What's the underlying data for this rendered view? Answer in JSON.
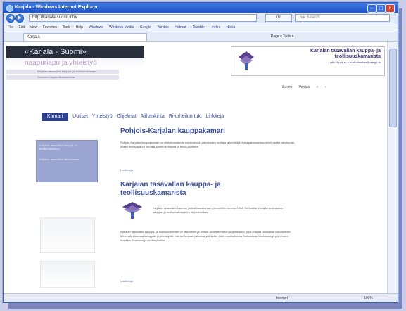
{
  "window": {
    "title": "Karjala - Windows Internet Explorer",
    "address": "http://karjala-suomi.info/",
    "search_placeholder": "Live Search",
    "go_label": "Go",
    "tab_label": "Karjala"
  },
  "menus": [
    "File",
    "Edit",
    "View",
    "Favorites",
    "Tools",
    "Help"
  ],
  "links": [
    "Windows",
    "Windows Media",
    "Google",
    "Yandex",
    "Hotmail",
    "Rambler",
    "Index",
    "Nokia"
  ],
  "tab_tools": "Page ▾  Tools ▾",
  "site": {
    "title": "«Karjala - Suomi»",
    "subtitle": "naapuriapu ja yhteistyö",
    "line1": "Karjalan tasavallan kauppa- ja teollisuuskamari",
    "line2": "Suomen-Karjala liiketoimintaa"
  },
  "banner": {
    "line1": "Karjalan tasavallan kauppa- ja",
    "line2": "teollisuuskamarista",
    "line3": "http://kppk.ru   e-mail:chamber@onego.ru"
  },
  "lang_links": [
    "Suomi",
    "Venäjä",
    "»",
    "«"
  ],
  "nav": {
    "active": "Kamari",
    "items": [
      "Uutiset",
      "Yhteistyö",
      "Ohjelmat",
      "Alihankinta",
      "Ri-urheilun tuki",
      "Linkkejä"
    ]
  },
  "left_box": {
    "item1": "Karjalan tasavallan kauppa- ja teollisuuskamari",
    "item2": "Karjalan tasavallan talousalueet"
  },
  "article1": {
    "title": "Pohjois-Karjalan kauppakamari",
    "body": "Pohjois-Karjalan kauppakamari on elinkeinoelämän edunvalvoja, palveluiden tuottaja ja kehittäjä. Kauppakamarissa toimii useita valiokuntia, joiden tehtävänä on seurata alueen kehitystä ja tehdä aloitteita.",
    "more": "Lisätietoja"
  },
  "article2": {
    "title": "Karjalan tasavallan kauppa- ja teollisuuskamarista",
    "intro": "Karjalan tasavallan kauppa- ja teollisuuskamari perustettiin vuonna 1992. Se kuuluu Venäjän federaation kauppa- ja teollisuuskamarien järjestelmään.",
    "body": "Karjalan tasavallan kauppa- ja teollisuuskamari on itsenäinen ja voittoa tavoittelematon organisaatio, joka edistää tasavallan taloudellista kehitystä, ulkomaankauppaa ja yhteistyötä. Kamari tarjoaa palveluja yrityksille, kuten konsultointia, todistuksia, koulutusta ja yhteyksien luomista Suomeen ja muihin maihin.",
    "more": "Lisätietoja"
  },
  "status": {
    "zone": "Internet",
    "zoom": "100%"
  },
  "colors": {
    "titlebar": "#1f56c9",
    "accent": "#3a4fa0",
    "header_dark": "#2a2f3c",
    "nav_active": "#2b3f8c",
    "left_box": "#9aa6d1"
  }
}
